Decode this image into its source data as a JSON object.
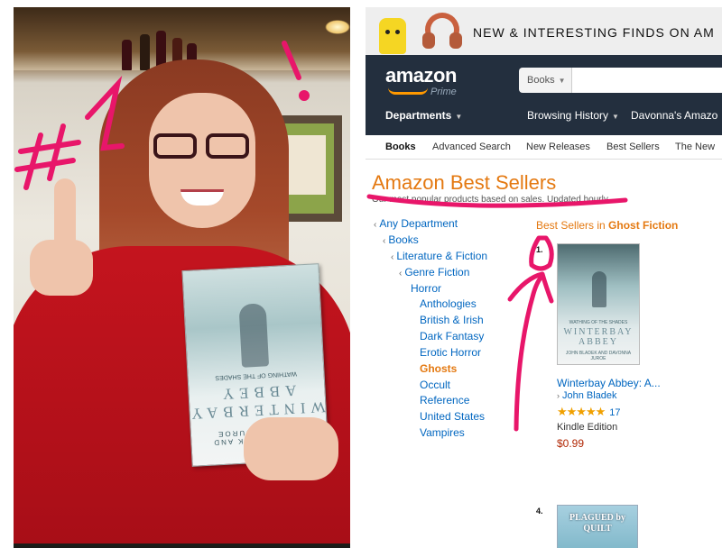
{
  "promo": {
    "text": "NEW & INTERESTING FINDS ON AM"
  },
  "header": {
    "logo": "amazon",
    "logo_sub": "Prime",
    "search_scope": "Books",
    "nav": {
      "departments": "Departments",
      "browsing_history": "Browsing History",
      "account": "Davonna's Amazo"
    }
  },
  "subnav": [
    "Books",
    "Advanced Search",
    "New Releases",
    "Best Sellers",
    "The New"
  ],
  "page": {
    "title": "Amazon Best Sellers",
    "subtitle": "Our most popular products based on sales. Updated hourly."
  },
  "categories": [
    {
      "label": "Any Department",
      "arrow": "‹"
    },
    {
      "label": "Books",
      "arrow": "‹"
    },
    {
      "label": "Literature & Fiction",
      "arrow": "‹"
    },
    {
      "label": "Genre Fiction",
      "arrow": "‹"
    },
    {
      "label": "Horror",
      "arrow": ""
    },
    {
      "label": "Anthologies",
      "arrow": ""
    },
    {
      "label": "British & Irish",
      "arrow": ""
    },
    {
      "label": "Dark Fantasy",
      "arrow": ""
    },
    {
      "label": "Erotic Horror",
      "arrow": ""
    },
    {
      "label": "Ghosts",
      "arrow": ""
    },
    {
      "label": "Occult",
      "arrow": ""
    },
    {
      "label": "Reference",
      "arrow": ""
    },
    {
      "label": "United States",
      "arrow": ""
    },
    {
      "label": "Vampires",
      "arrow": ""
    }
  ],
  "best_sellers_in": {
    "prefix": "Best Sellers in",
    "category": "Ghost Fiction"
  },
  "products": [
    {
      "rank": "1.",
      "cover_series": "WATHING OF THE SHADES",
      "cover_title": "WINTERBAY ABBEY",
      "cover_author": "JOHN BLADEK AND DAVONNA JUROE",
      "title": "Winterbay Abbey: A...",
      "author": "John Bladek",
      "author_arrow": "›",
      "stars": "★★★★★",
      "reviews": "17",
      "format": "Kindle Edition",
      "price": "$0.99"
    },
    {
      "rank": "4.",
      "cover_title": "PLAGUED by QUILT"
    }
  ],
  "photo": {
    "book_series": "WATHING OF THE SHADES",
    "book_title": "WINTERBAY ABBEY",
    "book_author": "JOHN BLADEK AND DAVONNA JUROE"
  },
  "annotation": {
    "text": "#1 !",
    "color": "#e8166a"
  },
  "colors": {
    "amazon_nav": "#232f3e",
    "orange": "#e47911",
    "link": "#0066c0",
    "price": "#b12704",
    "sweater": "#c4141e"
  }
}
